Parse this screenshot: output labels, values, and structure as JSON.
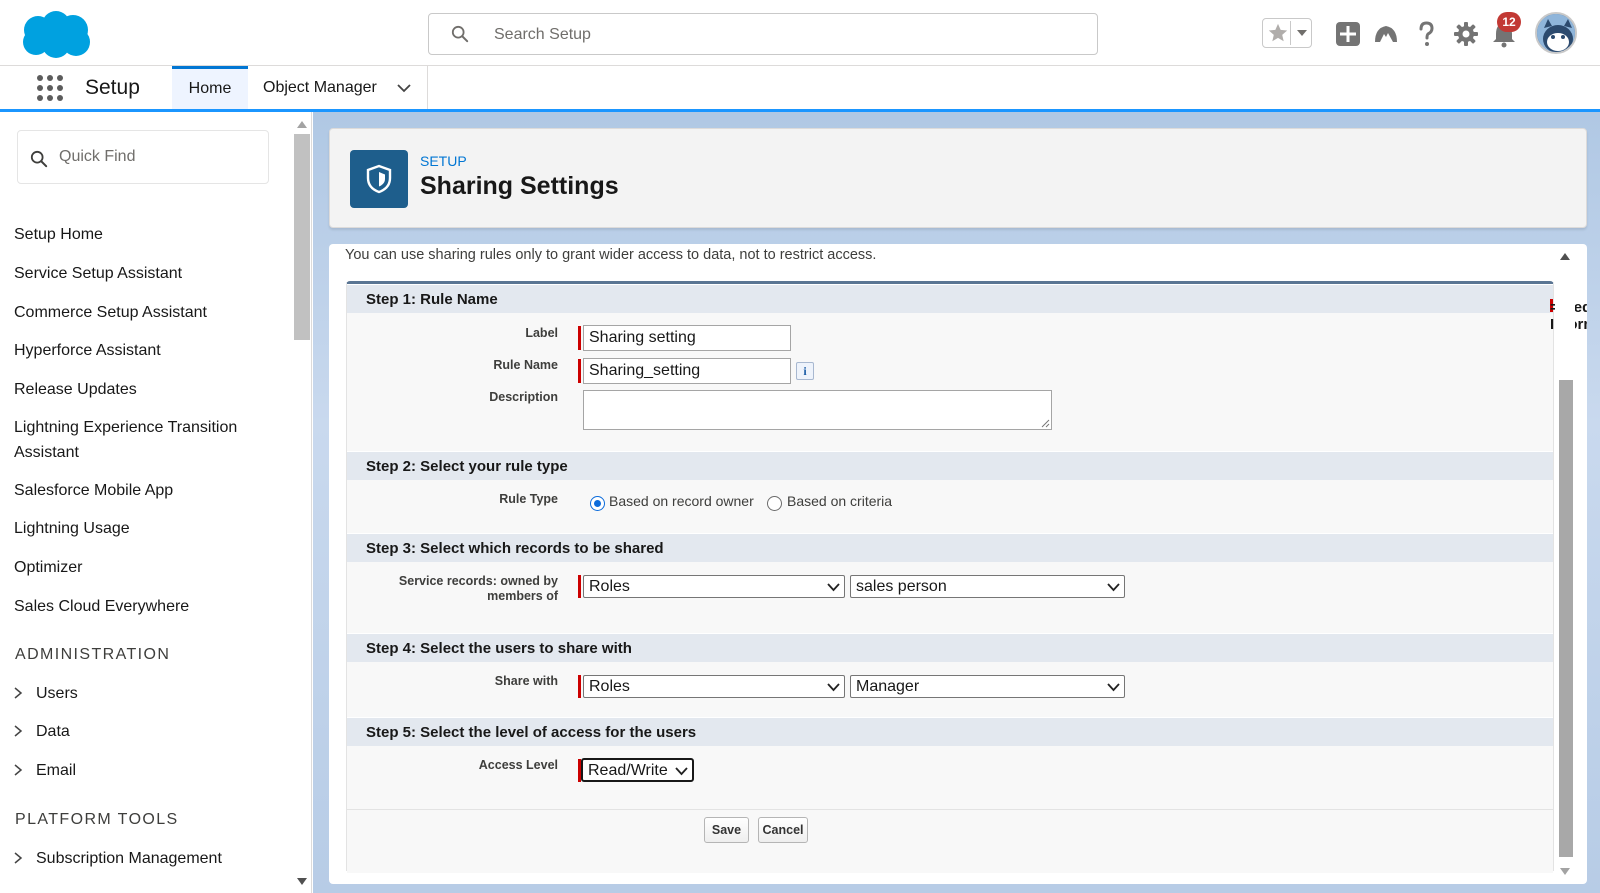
{
  "header": {
    "search_placeholder": "Search Setup",
    "notification_count": "12"
  },
  "context": {
    "app_name": "Setup",
    "tabs": [
      {
        "label": "Home",
        "active": true
      },
      {
        "label": "Object Manager",
        "active": false
      }
    ]
  },
  "sidebar": {
    "quick_find_placeholder": "Quick Find",
    "items": [
      "Setup Home",
      "Service Setup Assistant",
      "Commerce Setup Assistant",
      "Hyperforce Assistant",
      "Release Updates",
      "Lightning Experience Transition Assistant",
      "Salesforce Mobile App",
      "Lightning Usage",
      "Optimizer",
      "Sales Cloud Everywhere"
    ],
    "section_administration": "ADMINISTRATION",
    "admin_items": [
      "Users",
      "Data",
      "Email"
    ],
    "section_platform_tools": "PLATFORM TOOLS",
    "platform_items": [
      "Subscription Management"
    ]
  },
  "page_header": {
    "eyebrow": "SETUP",
    "title": "Sharing Settings"
  },
  "form": {
    "intro": "You can use sharing rules only to grant wider access to data, not to restrict access.",
    "required_info": "= Required Information",
    "step1": {
      "title": "Step 1: Rule Name",
      "label_label": "Label",
      "label_value": "Sharing setting",
      "rule_name_label": "Rule Name",
      "rule_name_value": "Sharing_setting",
      "description_label": "Description",
      "description_value": ""
    },
    "step2": {
      "title": "Step 2: Select your rule type",
      "rule_type_label": "Rule Type",
      "options": [
        "Based on record owner",
        "Based on criteria"
      ],
      "selected": "Based on record owner"
    },
    "step3": {
      "title": "Step 3: Select which records to be shared",
      "field_label_line1": "Service records: owned by",
      "field_label_line2": "members of",
      "select1": "Roles",
      "select2": "sales person"
    },
    "step4": {
      "title": "Step 4: Select the users to share with",
      "field_label": "Share with",
      "select1": "Roles",
      "select2": "Manager"
    },
    "step5": {
      "title": "Step 5: Select the level of access for the users",
      "field_label": "Access Level",
      "select": "Read/Write"
    },
    "buttons": {
      "save": "Save",
      "cancel": "Cancel"
    }
  },
  "colors": {
    "brand_blue": "#0176d3",
    "cloud_logo": "#00a1e0",
    "required": "#cc0000",
    "badge": "#c23934"
  }
}
